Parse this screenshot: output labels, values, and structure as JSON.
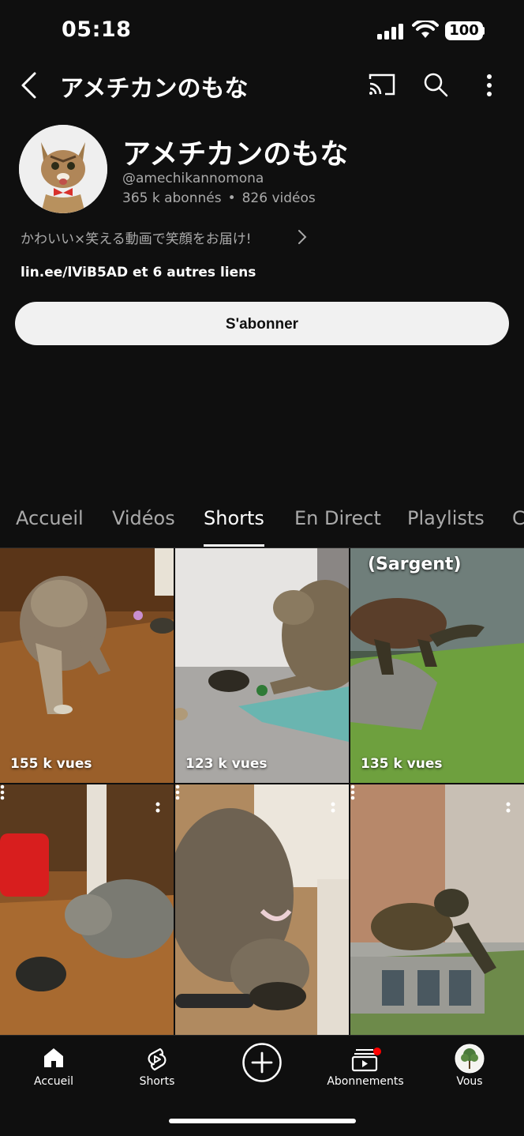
{
  "status_bar": {
    "time": "05:18",
    "battery": "100"
  },
  "header": {
    "title": "アメチカンのもな"
  },
  "channel": {
    "name": "アメチカンのもな",
    "handle": "@amechikannomona",
    "subscribers": "365 k abonnés",
    "videos": "826 vidéos",
    "description": "かわいい×笑える動画で笑顔をお届け!",
    "links": "lin.ee/lViB5AD et 6 autres liens",
    "subscribe_label": "S'abonner"
  },
  "tabs": [
    {
      "label": "Accueil",
      "active": false
    },
    {
      "label": "Vidéos",
      "active": false
    },
    {
      "label": "Shorts",
      "active": true
    },
    {
      "label": "En Direct",
      "active": false
    },
    {
      "label": "Playlists",
      "active": false
    },
    {
      "label": "C",
      "active": false
    }
  ],
  "shorts": [
    {
      "views": "155 k vues",
      "overlay": ""
    },
    {
      "views": "123 k vues",
      "overlay": ""
    },
    {
      "views": "135 k vues",
      "overlay": "(Sargent)"
    },
    {
      "views": "",
      "overlay": ""
    },
    {
      "views": "",
      "overlay": ""
    },
    {
      "views": "",
      "overlay": ""
    }
  ],
  "bottom_nav": [
    {
      "label": "Accueil",
      "icon": "home-icon"
    },
    {
      "label": "Shorts",
      "icon": "shorts-icon"
    },
    {
      "label": "",
      "icon": "create-icon"
    },
    {
      "label": "Abonnements",
      "icon": "subscriptions-icon",
      "badge": true
    },
    {
      "label": "Vous",
      "icon": "profile-avatar"
    }
  ],
  "colors": {
    "background": "#0f0f0f",
    "notification_dot": "#ff0000",
    "subscribe_bg": "#f1f1f1"
  }
}
